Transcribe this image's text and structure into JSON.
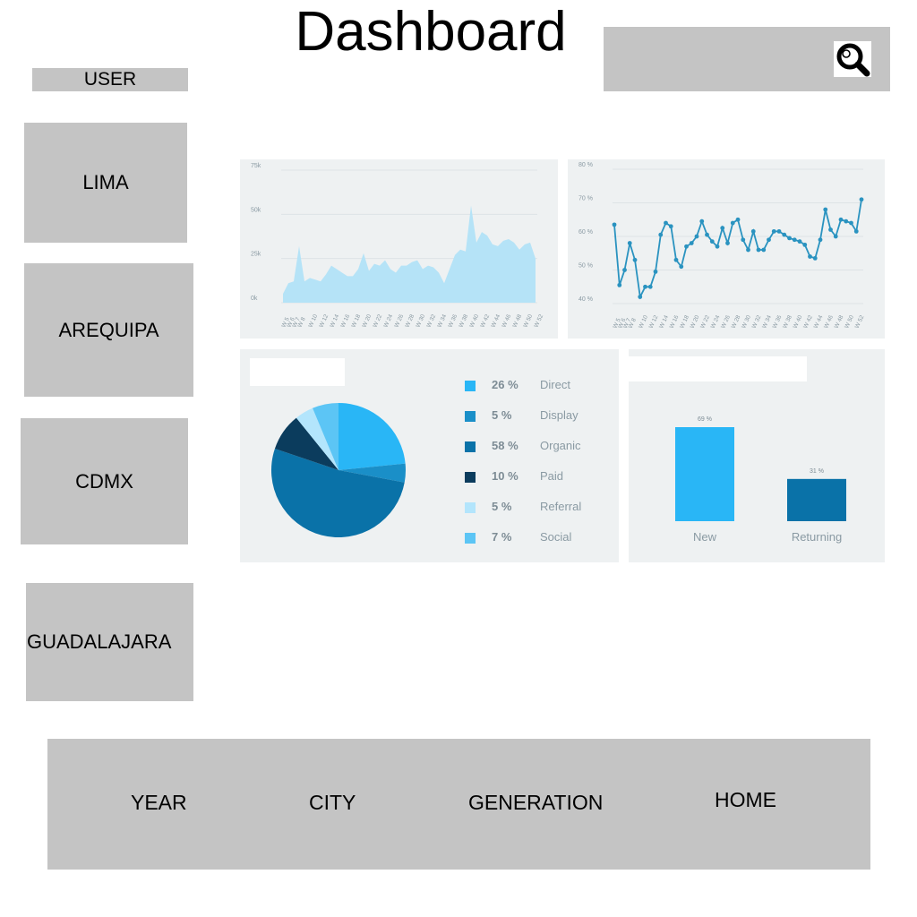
{
  "header": {
    "title": "Dashboard"
  },
  "search": {
    "icon": "search-icon"
  },
  "sidebar": {
    "user_label": "USER",
    "cities": [
      {
        "label": "LIMA"
      },
      {
        "label": "AREQUIPA"
      },
      {
        "label": "CDMX"
      },
      {
        "label": "GUADALAJARA"
      }
    ]
  },
  "bottom_nav": {
    "items": [
      {
        "label": "YEAR"
      },
      {
        "label": "CITY"
      },
      {
        "label": "GENERATION"
      },
      {
        "label": "HOME"
      }
    ]
  },
  "colors": {
    "sidebar_gray": "#c4c4c4",
    "panel_bg": "#eef1f2",
    "area_fill": "#b5e3f7",
    "line_color": "#2a93c0",
    "pie_direct": "#29b6f6",
    "pie_display": "#1a8fc8",
    "pie_organic": "#0a72a8",
    "pie_paid": "#0b3c5d",
    "pie_referral": "#b3e5fc",
    "pie_social": "#5cc5f5"
  },
  "chart_data": [
    {
      "type": "area",
      "yticks": [
        "75k",
        "50k",
        "25k",
        "0k"
      ],
      "ylim": [
        0,
        75000
      ],
      "x": [
        "W 5",
        "W 6",
        "W 7",
        "W 8",
        "W 9",
        "W 10",
        "W 11",
        "W 12",
        "W 13",
        "W 14",
        "W 15",
        "W 16",
        "W 17",
        "W 18",
        "W 19",
        "W 20",
        "W 21",
        "W 22",
        "W 23",
        "W 24",
        "W 25",
        "W 26",
        "W 27",
        "W 28",
        "W 29",
        "W 30",
        "W 31",
        "W 32",
        "W 33",
        "W 34",
        "W 35",
        "W 36",
        "W 37",
        "W 38",
        "W 39",
        "W 40",
        "W 41",
        "W 42",
        "W 43",
        "W 44",
        "W 45",
        "W 46",
        "W 47",
        "W 48",
        "W 49",
        "W 50",
        "W 51",
        "W 52"
      ],
      "xtick_labels": [
        "W 5",
        "W 6",
        "W 7",
        "W 8",
        "W 10",
        "W 12",
        "W 14",
        "W 16",
        "W 18",
        "W 20",
        "W 22",
        "W 24",
        "W 26",
        "W 28",
        "W 30",
        "W 32",
        "W 34",
        "W 36",
        "W 38",
        "W 40",
        "W 42",
        "W 44",
        "W 46",
        "W 48",
        "W 50",
        "W 52"
      ],
      "values": [
        5000,
        11000,
        12000,
        32000,
        12000,
        14000,
        13000,
        12000,
        16000,
        21000,
        19000,
        17000,
        15000,
        15000,
        19000,
        28000,
        18000,
        22000,
        21000,
        24000,
        19000,
        17000,
        21000,
        21000,
        23000,
        24000,
        19000,
        21000,
        20000,
        17000,
        11000,
        19000,
        27000,
        30000,
        29000,
        55000,
        34000,
        40000,
        38000,
        33000,
        32000,
        35000,
        36000,
        34000,
        30000,
        33000,
        34000,
        25000
      ],
      "grid": true
    },
    {
      "type": "line",
      "yticks": [
        "80 %",
        "70 %",
        "60 %",
        "50 %",
        "40 %"
      ],
      "ylim": [
        40,
        80
      ],
      "x": [
        "W 5",
        "W 6",
        "W 7",
        "W 8",
        "W 9",
        "W 10",
        "W 11",
        "W 12",
        "W 13",
        "W 14",
        "W 15",
        "W 16",
        "W 17",
        "W 18",
        "W 19",
        "W 20",
        "W 21",
        "W 22",
        "W 23",
        "W 24",
        "W 25",
        "W 26",
        "W 27",
        "W 28",
        "W 29",
        "W 30",
        "W 31",
        "W 32",
        "W 33",
        "W 34",
        "W 35",
        "W 36",
        "W 37",
        "W 38",
        "W 39",
        "W 40",
        "W 41",
        "W 42",
        "W 43",
        "W 44",
        "W 45",
        "W 46",
        "W 47",
        "W 48",
        "W 49",
        "W 50",
        "W 51",
        "W 52"
      ],
      "xtick_labels": [
        "W 5",
        "W 6",
        "W 7",
        "W 8",
        "W 10",
        "W 12",
        "W 14",
        "W 16",
        "W 18",
        "W 20",
        "W 22",
        "W 24",
        "W 26",
        "W 28",
        "W 30",
        "W 32",
        "W 34",
        "W 36",
        "W 38",
        "W 40",
        "W 42",
        "W 44",
        "W 46",
        "W 48",
        "W 50",
        "W 52"
      ],
      "values": [
        63.5,
        45.5,
        50,
        58,
        53,
        42,
        45,
        45,
        49.5,
        60.5,
        64,
        63,
        53,
        51,
        57,
        58,
        60,
        64.5,
        60.5,
        58.5,
        57,
        62.5,
        58,
        64,
        65,
        59,
        56,
        61.5,
        56,
        56,
        59,
        61.5,
        61.5,
        60.5,
        59.5,
        59,
        58.5,
        57.5,
        54,
        53.5,
        59,
        68,
        62,
        60,
        65,
        64.5,
        64,
        61.5,
        71
      ],
      "grid": true
    },
    {
      "type": "pie",
      "slices": [
        {
          "label": "Direct",
          "pct": "26 %",
          "value": 26,
          "color": "#29b6f6"
        },
        {
          "label": "Display",
          "pct": "5 %",
          "value": 5,
          "color": "#1a8fc8"
        },
        {
          "label": "Organic",
          "pct": "58 %",
          "value": 58,
          "color": "#0a72a8"
        },
        {
          "label": "Paid",
          "pct": "10 %",
          "value": 10,
          "color": "#0b3c5d"
        },
        {
          "label": "Referral",
          "pct": "5 %",
          "value": 5,
          "color": "#b3e5fc"
        },
        {
          "label": "Social",
          "pct": "7 %",
          "value": 7,
          "color": "#5cc5f5"
        }
      ]
    },
    {
      "type": "bar",
      "categories": [
        "New",
        "Returning"
      ],
      "values": [
        69,
        31
      ],
      "data_labels": [
        "69 %",
        "31 %"
      ],
      "colors": [
        "#29b6f6",
        "#0a72a8"
      ]
    }
  ]
}
